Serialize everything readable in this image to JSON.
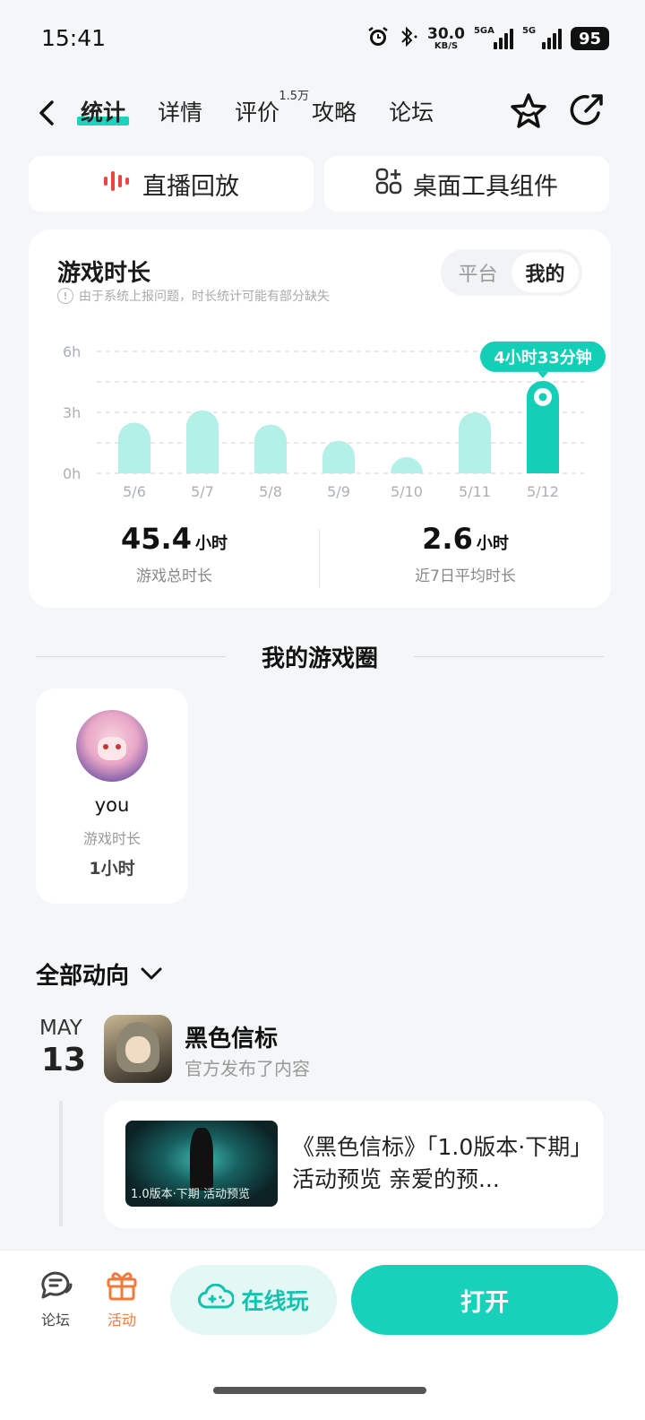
{
  "status_bar": {
    "time": "15:41",
    "net_speed_value": "30.0",
    "net_speed_unit": "KB/S",
    "signal1_label": "5GA",
    "signal2_label": "5G",
    "battery": "95"
  },
  "nav": {
    "tabs": [
      {
        "label": "统计",
        "active": true
      },
      {
        "label": "详情"
      },
      {
        "label": "评价",
        "badge": "1.5万"
      },
      {
        "label": "攻略"
      },
      {
        "label": "论坛"
      }
    ]
  },
  "quick_buttons": {
    "live_replay": "直播回放",
    "desktop_widget": "桌面工具组件"
  },
  "playtime": {
    "title": "游戏时长",
    "note": "由于系统上报问题，时长统计可能有部分缺失",
    "toggle": [
      "平台",
      "我的"
    ],
    "toggle_selected": "我的",
    "total_value": "45.4",
    "total_unit": "小时",
    "total_label": "游戏总时长",
    "avg_value": "2.6",
    "avg_unit": "小时",
    "avg_label": "近7日平均时长"
  },
  "chart_data": {
    "type": "bar",
    "categories": [
      "5/6",
      "5/7",
      "5/8",
      "5/9",
      "5/10",
      "5/11",
      "5/12"
    ],
    "values": [
      2.5,
      3.1,
      2.4,
      1.6,
      0.8,
      3.0,
      4.55
    ],
    "ylim": [
      0,
      6
    ],
    "yticks": [
      "0h",
      "3h",
      "6h"
    ],
    "highlight_index": 6,
    "highlight_label": "4小时33分钟",
    "grid": true,
    "colors": {
      "bar": "#b3f0e8",
      "highlight": "#14cfb8"
    }
  },
  "circle": {
    "title": "我的游戏圈",
    "friend_name": "you",
    "friend_label": "游戏时长",
    "friend_time": "1小时"
  },
  "feed": {
    "filter_label": "全部动向",
    "month": "MAY",
    "day": "13",
    "author": "黑色信标",
    "action": "官方发布了内容",
    "thumb_caption": "1.0版本·下期 活动预览",
    "post_text": "《黑色信标》「1.0版本·下期」活动预览 亲爱的预..."
  },
  "bottom": {
    "forum": "论坛",
    "activity": "活动",
    "play_online": "在线玩",
    "open": "打开"
  },
  "colors": {
    "accent": "#17d1bb",
    "activity": "#f07a3a"
  }
}
